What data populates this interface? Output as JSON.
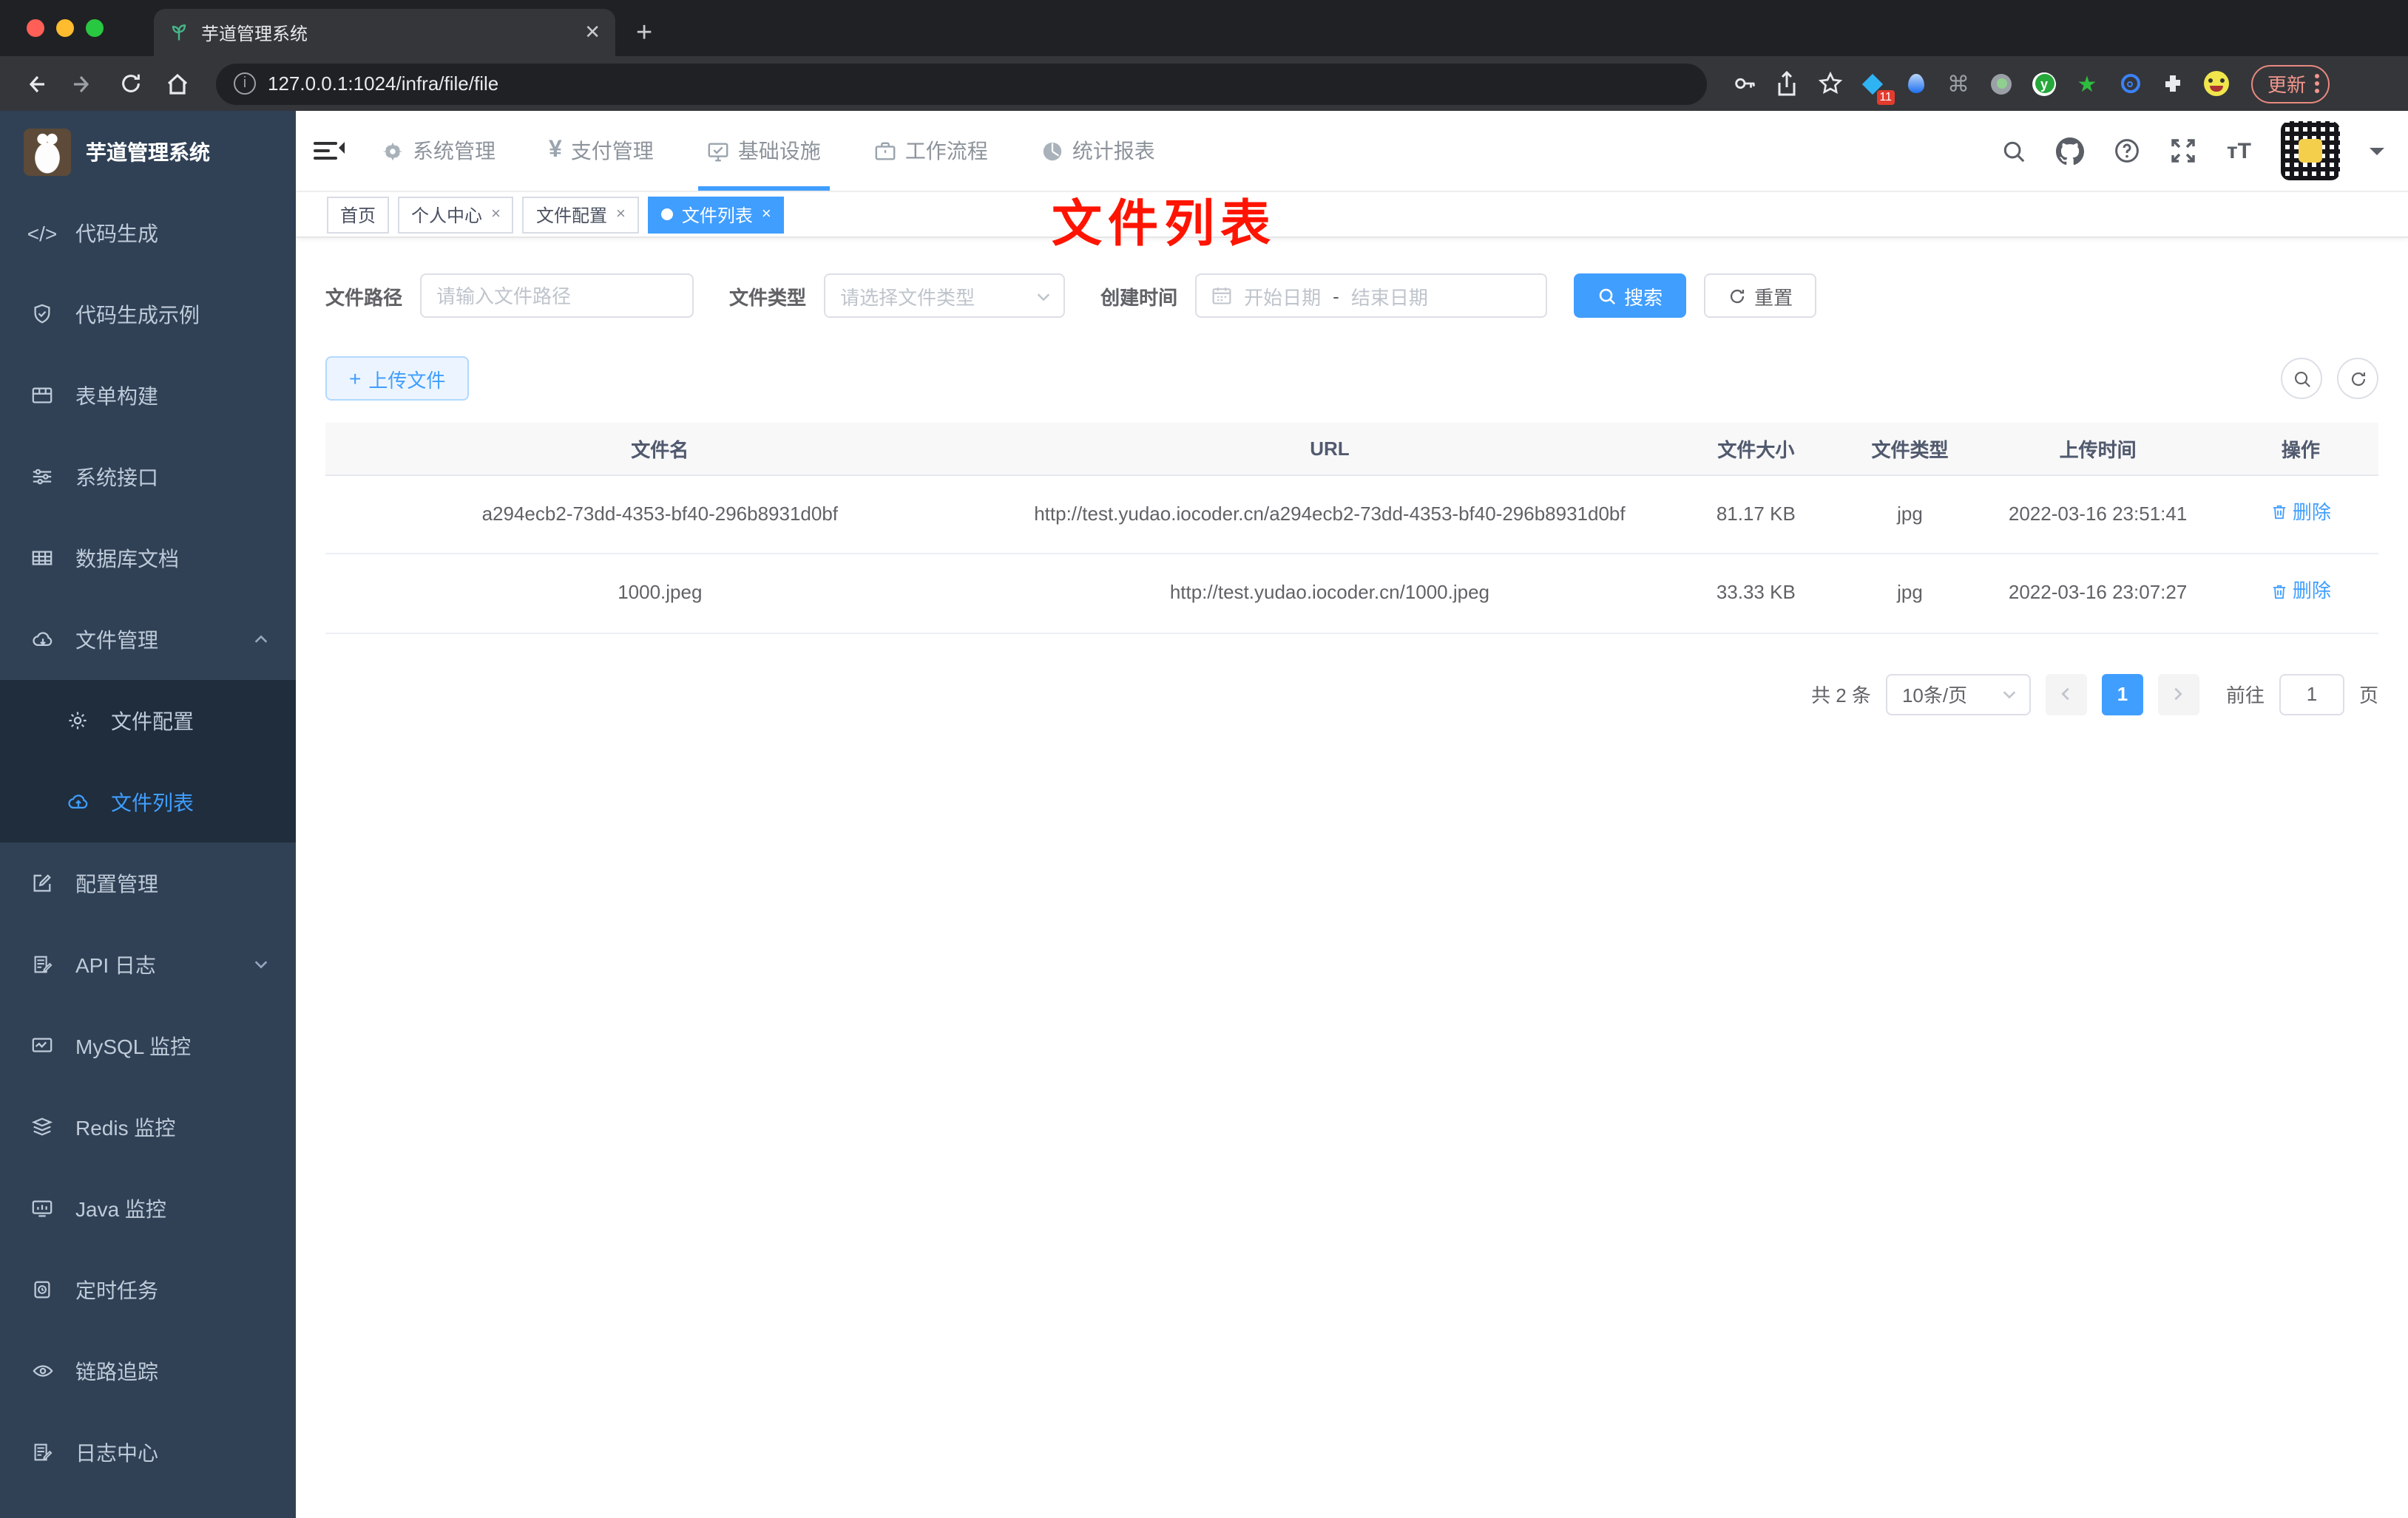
{
  "browser": {
    "tab_title": "芋道管理系统",
    "tab_close": "✕",
    "new_tab": "+",
    "url": "127.0.0.1:1024/infra/file/file",
    "extension_badge": "11",
    "extension_y": "y",
    "update_button": "更新"
  },
  "header": {
    "nav": [
      {
        "label": "系统管理"
      },
      {
        "label": "支付管理"
      },
      {
        "label": "基础设施"
      },
      {
        "label": "工作流程"
      },
      {
        "label": "统计报表"
      }
    ],
    "text_size_icon": "тT"
  },
  "sidebar": {
    "title": "芋道管理系统",
    "items": [
      {
        "label": "代码生成"
      },
      {
        "label": "代码生成示例"
      },
      {
        "label": "表单构建"
      },
      {
        "label": "系统接口"
      },
      {
        "label": "数据库文档"
      },
      {
        "label": "文件管理"
      },
      {
        "label": "文件配置"
      },
      {
        "label": "文件列表"
      },
      {
        "label": "配置管理"
      },
      {
        "label": "API 日志"
      },
      {
        "label": "MySQL 监控"
      },
      {
        "label": "Redis 监控"
      },
      {
        "label": "Java 监控"
      },
      {
        "label": "定时任务"
      },
      {
        "label": "链路追踪"
      },
      {
        "label": "日志中心"
      }
    ]
  },
  "tags": [
    {
      "label": "首页"
    },
    {
      "label": "个人中心",
      "close": "×"
    },
    {
      "label": "文件配置",
      "close": "×"
    },
    {
      "label": "文件列表",
      "close": "×"
    }
  ],
  "annotation": "文件列表",
  "filters": {
    "path_label": "文件路径",
    "path_placeholder": "请输入文件路径",
    "type_label": "文件类型",
    "type_placeholder": "请选择文件类型",
    "time_label": "创建时间",
    "start_placeholder": "开始日期",
    "range_separator": "-",
    "end_placeholder": "结束日期",
    "search_label": "搜索",
    "reset_label": "重置"
  },
  "toolbar": {
    "upload_label": "上传文件",
    "upload_plus": "+"
  },
  "table": {
    "headers": [
      "文件名",
      "URL",
      "文件大小",
      "文件类型",
      "上传时间",
      "操作"
    ],
    "rows": [
      {
        "name": "a294ecb2-73dd-4353-bf40-296b8931d0bf",
        "url": "http://test.yudao.iocoder.cn/a294ecb2-73dd-4353-bf40-296b8931d0bf",
        "size": "81.17 KB",
        "type": "jpg",
        "time": "2022-03-16 23:51:41",
        "action": "删除"
      },
      {
        "name": "1000.jpeg",
        "url": "http://test.yudao.iocoder.cn/1000.jpeg",
        "size": "33.33 KB",
        "type": "jpg",
        "time": "2022-03-16 23:07:27",
        "action": "删除"
      }
    ]
  },
  "pagination": {
    "total": "共 2 条",
    "page_size": "10条/页",
    "current_page": "1",
    "goto_label": "前往",
    "goto_value": "1",
    "page_unit": "页"
  },
  "colors": {
    "accent": "#409eff",
    "sidebar_bg": "#304156",
    "submenu_bg": "#1f2d3d",
    "annotation_red": "#fe1400",
    "table_header_bg": "#f8f8f9"
  }
}
